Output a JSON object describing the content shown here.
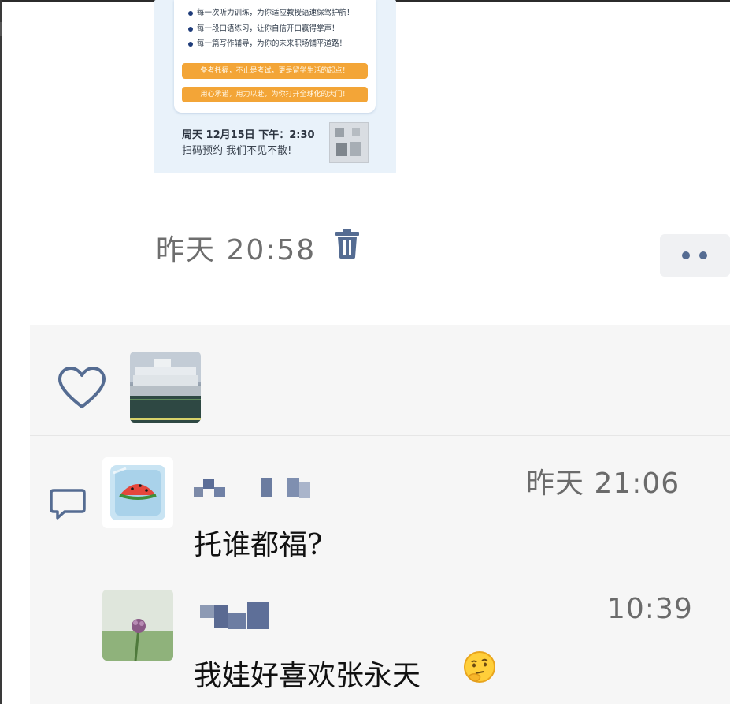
{
  "post": {
    "poster": {
      "bullets": [
        "每一次听力训练，为你适应教授语速保驾护航！",
        "每一段口语练习，让你自信开口赢得掌声！",
        "每一篇写作辅导，为你的未来职场铺平道路！"
      ],
      "banners": [
        "备考托福，不止是考试，更是留学生活的起点！",
        "用心承诺，用力以赴，为你打开全球化的大门！"
      ],
      "date_line": "周天 12月15日 下午：2:30",
      "scan_line": "扫码预约 我们不见不散!"
    },
    "timestamp": "昨天 20:58",
    "delete_icon": "trash-icon",
    "more_icon": "more-dots-icon"
  },
  "interactions": {
    "like_icon": "heart-icon",
    "comment_icon": "comment-icon",
    "likers": [
      "ship-photo-avatar"
    ],
    "comments": [
      {
        "avatar": "watermelon-ice-avatar",
        "author": "",
        "time": "昨天 21:06",
        "text": "托谁都福?"
      },
      {
        "avatar": "flower-avatar",
        "author": "",
        "time": "10:39",
        "text": "我娃好喜欢张永天"
      }
    ]
  },
  "colors": {
    "panel_bg": "#f6f6f6",
    "icon_blue": "#556c92",
    "timestamp_gray": "#6e6e6e",
    "banner_orange": "#f3a537",
    "poster_bg": "#e9f2fa"
  }
}
